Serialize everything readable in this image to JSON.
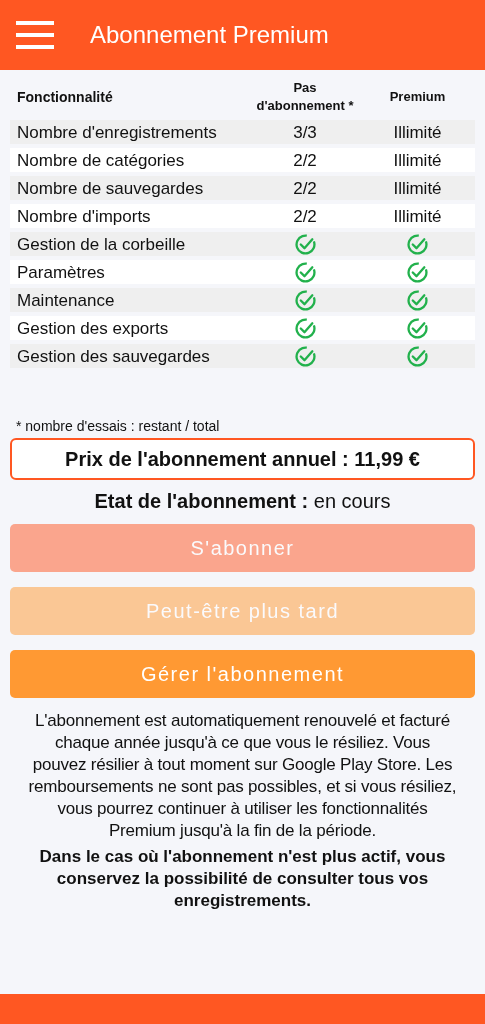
{
  "app_bar": {
    "title": "Abonnement Premium"
  },
  "table": {
    "columns": [
      "Fonctionnalité",
      "Pas d'abonnement *",
      "Premium"
    ],
    "rows": [
      {
        "cells": [
          {
            "kind": "text",
            "text": "Nombre d'enregistrements"
          },
          {
            "kind": "text",
            "text": "3/3"
          },
          {
            "kind": "text",
            "text": "Illimité"
          }
        ]
      },
      {
        "cells": [
          {
            "kind": "text",
            "text": "Nombre de catégories"
          },
          {
            "kind": "text",
            "text": "2/2"
          },
          {
            "kind": "text",
            "text": "Illimité"
          }
        ]
      },
      {
        "cells": [
          {
            "kind": "text",
            "text": "Nombre de sauvegardes"
          },
          {
            "kind": "text",
            "text": "2/2"
          },
          {
            "kind": "text",
            "text": "Illimité"
          }
        ]
      },
      {
        "cells": [
          {
            "kind": "text",
            "text": "Nombre d'imports"
          },
          {
            "kind": "text",
            "text": "2/2"
          },
          {
            "kind": "text",
            "text": "Illimité"
          }
        ]
      },
      {
        "cells": [
          {
            "kind": "text",
            "text": "Gestion de la corbeille"
          },
          {
            "kind": "check"
          },
          {
            "kind": "check"
          }
        ]
      },
      {
        "cells": [
          {
            "kind": "text",
            "text": "Paramètres"
          },
          {
            "kind": "check"
          },
          {
            "kind": "check"
          }
        ]
      },
      {
        "cells": [
          {
            "kind": "text",
            "text": "Maintenance"
          },
          {
            "kind": "check"
          },
          {
            "kind": "check"
          }
        ]
      },
      {
        "cells": [
          {
            "kind": "text",
            "text": "Gestion des exports"
          },
          {
            "kind": "check"
          },
          {
            "kind": "check"
          }
        ]
      },
      {
        "cells": [
          {
            "kind": "text",
            "text": "Gestion des sauvegardes"
          },
          {
            "kind": "check"
          },
          {
            "kind": "check"
          }
        ]
      }
    ]
  },
  "footnote": "* nombre d'essais : restant / total",
  "price": "Prix de l'abonnement annuel : 11,99 €",
  "status": "**Etat de l'abonnement :** en cours",
  "buttons": [
    {
      "label": "S'abonner",
      "kind": "primary",
      "disabled": true
    },
    {
      "label": "Peut-être plus tard",
      "kind": "secondary",
      "disabled": true
    },
    {
      "label": "Gérer l'abonnement",
      "kind": "secondary",
      "disabled": false
    }
  ],
  "info": "L'abonnement est automatiquement renouvelé et facturé chaque année jusqu'à ce que vous le résiliez. Vous pouvez résilier à tout moment sur Google Play Store. Les remboursements ne sont pas possibles, et si vous résiliez, vous pourrez continuer à utiliser les fonctionnalités Premium jusqu'à la fin de la période.",
  "note": "Dans le cas où l'abonnement n'est plus actif, vous conservez la possibilité de consulter tous vos enregistrements."
}
